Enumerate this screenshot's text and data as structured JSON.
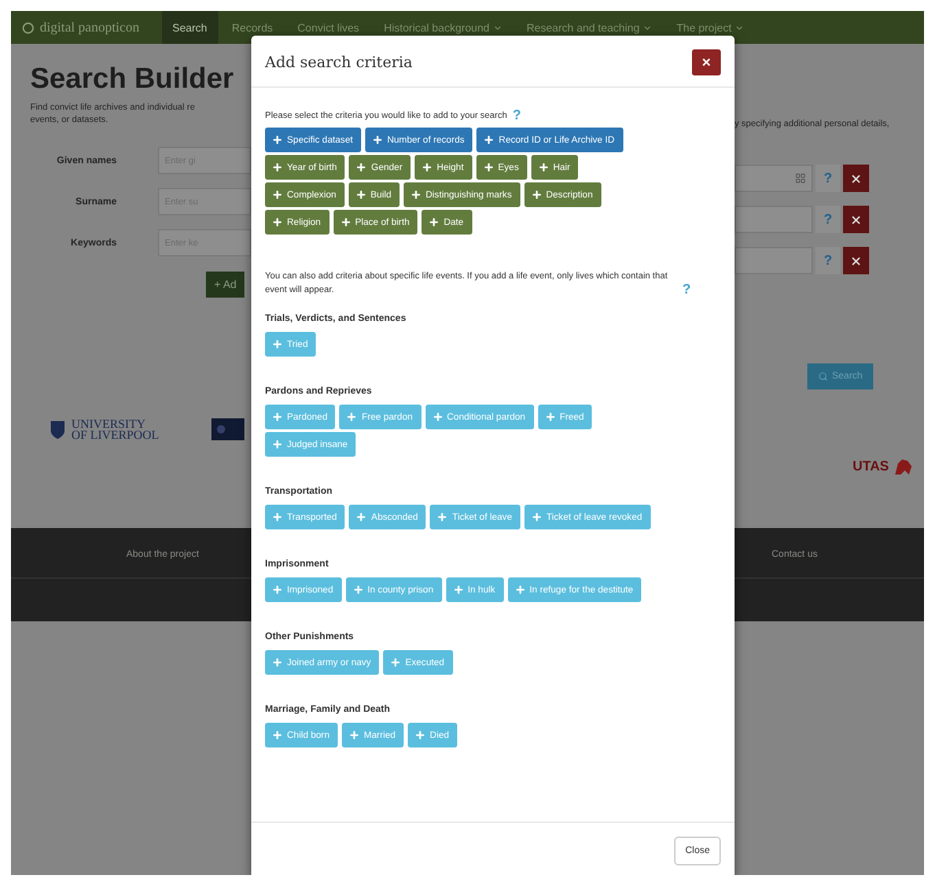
{
  "navbar": {
    "brand": "digital panopticon",
    "items": [
      {
        "label": "Search",
        "selected": true,
        "dropdown": false
      },
      {
        "label": "Records",
        "selected": false,
        "dropdown": false
      },
      {
        "label": "Convict lives",
        "selected": false,
        "dropdown": false
      },
      {
        "label": "Historical background",
        "selected": false,
        "dropdown": true
      },
      {
        "label": "Research and teaching",
        "selected": false,
        "dropdown": true
      },
      {
        "label": "The project",
        "selected": false,
        "dropdown": true
      }
    ]
  },
  "page": {
    "title": "Search Builder",
    "description_left": "Find convict life archives and individual re",
    "description_left_2": "events, or datasets.",
    "description_right": "y specifying additional personal details,",
    "fields": [
      {
        "label": "Given names",
        "placeholder": "Enter gi",
        "list_icon": true,
        "help": "?"
      },
      {
        "label": "Surname",
        "placeholder": "Enter su",
        "list_icon": false,
        "help": "?"
      },
      {
        "label": "Keywords",
        "placeholder": "Enter ke",
        "list_icon": false,
        "help": "?"
      }
    ],
    "add_button": "+ Ad",
    "search_button": "Search",
    "logo_left": "UNIVERSITY OF LIVERPOOL",
    "logo_right": "UTAS",
    "footer_left": "About the project",
    "footer_right": "Contact us"
  },
  "modal": {
    "title": "Add search criteria",
    "close": "×",
    "intro": "Please select the criteria you would like to add to your search",
    "help": "?",
    "criteria": [
      {
        "kind": "dataset",
        "label": "Specific dataset"
      },
      {
        "kind": "dataset",
        "label": "Number of records"
      },
      {
        "kind": "dataset",
        "label": "Record ID or Life Archive ID"
      },
      {
        "kind": "personal",
        "label": "Year of birth"
      },
      {
        "kind": "personal",
        "label": "Gender"
      },
      {
        "kind": "personal",
        "label": "Height"
      },
      {
        "kind": "personal",
        "label": "Eyes"
      },
      {
        "kind": "personal",
        "label": "Hair"
      },
      {
        "kind": "personal",
        "label": "Complexion"
      },
      {
        "kind": "personal",
        "label": "Build"
      },
      {
        "kind": "personal",
        "label": "Distinguishing marks"
      },
      {
        "kind": "personal",
        "label": "Description"
      },
      {
        "kind": "personal",
        "label": "Religion"
      },
      {
        "kind": "personal",
        "label": "Place of birth"
      },
      {
        "kind": "personal",
        "label": "Date"
      }
    ],
    "events_note": "You can also add criteria about specific life events. If you add a life event, only lives which contain that event will appear.",
    "sections": [
      {
        "title": "Trials, Verdicts, and Sentences",
        "buttons": [
          "Tried"
        ]
      },
      {
        "title": "Pardons and Reprieves",
        "buttons": [
          "Pardoned",
          "Free pardon",
          "Conditional pardon",
          "Freed",
          "Judged insane"
        ]
      },
      {
        "title": "Transportation",
        "buttons": [
          "Transported",
          "Absconded",
          "Ticket of leave",
          "Ticket of leave revoked"
        ]
      },
      {
        "title": "Imprisonment",
        "buttons": [
          "Imprisoned",
          "In county prison",
          "In hulk",
          "In refuge for the destitute"
        ]
      },
      {
        "title": "Other Punishments",
        "buttons": [
          "Joined army or navy",
          "Executed"
        ]
      },
      {
        "title": "Marriage, Family and Death",
        "buttons": [
          "Child born",
          "Married",
          "Died"
        ]
      }
    ],
    "close_button": "Close"
  }
}
